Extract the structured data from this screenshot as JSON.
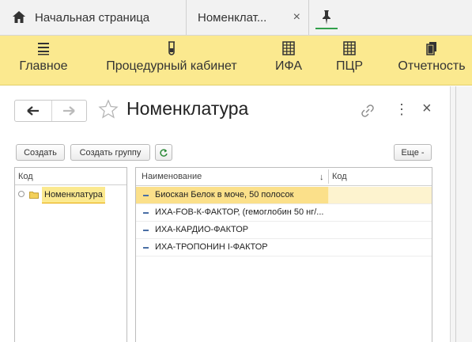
{
  "tabs": {
    "home_label": "Начальная страница",
    "nomenclature_label": "Номенклат...",
    "close_glyph": "×"
  },
  "sections": [
    {
      "label": "Главное",
      "icon": "menu-lines-icon"
    },
    {
      "label": "Процедурный кабинет",
      "icon": "test-tube-icon"
    },
    {
      "label": "ИФА",
      "icon": "grid-icon"
    },
    {
      "label": "ПЦР",
      "icon": "grid-icon"
    },
    {
      "label": "Отчетность",
      "icon": "documents-icon"
    }
  ],
  "form": {
    "title": "Номенклатура",
    "close_glyph": "×",
    "more_glyph": "⋮"
  },
  "toolbar": {
    "create_label": "Создать",
    "create_group_label": "Создать группу",
    "more_label": "Еще -"
  },
  "tree": {
    "header": "Код",
    "root_label": "Номенклатура"
  },
  "list": {
    "col_name": "Наименование",
    "sort_glyph": "↓",
    "col_code": "Код",
    "rows": [
      {
        "name": "Биоскан Белок в моче, 50 полосок",
        "selected": true
      },
      {
        "name": "ИХА-FOB-К-ФАКТОР, (гемоглобин 50 нг/...",
        "selected": false
      },
      {
        "name": "ИХА-КАРДИО-ФАКТОР",
        "selected": false
      },
      {
        "name": "ИХА-ТРОПОНИН I-ФАКТОР",
        "selected": false
      }
    ]
  },
  "colors": {
    "accent_yellow": "#fbe98f",
    "pin_green": "#31a04a",
    "selection": "#fbe08a"
  }
}
